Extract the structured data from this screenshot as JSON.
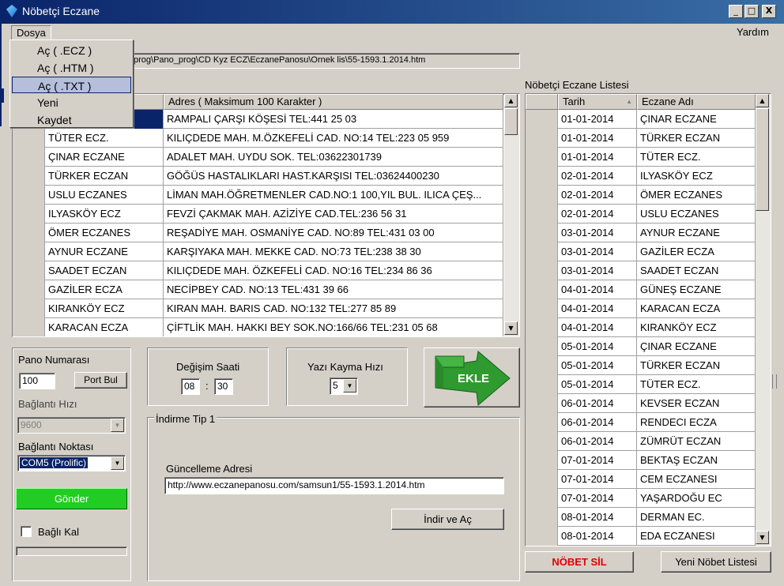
{
  "window": {
    "title": "Nöbetçi Eczane",
    "minimize": "_",
    "maximize": "□",
    "close": "X"
  },
  "menu": {
    "dosya": "Dosya",
    "yardim": "Yardım"
  },
  "dropdown": [
    "Aç ( .ECZ )",
    "Aç ( .HTM )",
    "Aç ( .TXT )",
    "Yeni",
    "Kaydet"
  ],
  "path": "prog\\Pano_prog\\CD Kyz ECZ\\EczanePanosu\\Ornek lis\\55-1593.1.2014.htm",
  "left_grid": {
    "header_addr": "Adres  ( Maksimum 100 Karakter )",
    "rows": [
      {
        "name": "",
        "addr": "RAMPALI ÇARŞI KÖŞESİ TEL:441 25 03"
      },
      {
        "name": "TÜTER ECZ.",
        "addr": "KILIÇDEDE MAH. M.ÖZKEFELİ CAD. NO:14 TEL:223 05 959"
      },
      {
        "name": "ÇINAR ECZANE",
        "addr": "ADALET MAH. UYDU SOK. TEL:03622301739"
      },
      {
        "name": "TÜRKER ECZAN",
        "addr": "GÖĞÜS HASTALIKLARI HAST.KARŞISI TEL:03624400230"
      },
      {
        "name": "USLU ECZANES",
        "addr": "LİMAN MAH.ÖĞRETMENLER CAD.NO:1 100,YIL BUL. ILICA ÇEŞ..."
      },
      {
        "name": "ILYASKÖY ECZ",
        "addr": "FEVZİ ÇAKMAK MAH. AZİZİYE CAD.TEL:236 56 31"
      },
      {
        "name": "ÖMER ECZANES",
        "addr": "REŞADİYE MAH. OSMANİYE CAD. NO:89 TEL:431 03 00"
      },
      {
        "name": "AYNUR ECZANE",
        "addr": "KARŞIYAKA MAH. MEKKE CAD. NO:73  TEL:238 38 30"
      },
      {
        "name": "SAADET ECZAN",
        "addr": "KILIÇDEDE MAH. ÖZKEFELİ CAD. NO:16 TEL:234 86 36"
      },
      {
        "name": "GAZİLER ECZA",
        "addr": "NECİPBEY CAD. NO:13 TEL:431 39 66"
      },
      {
        "name": "KIRANKÖY ECZ",
        "addr": "KIRAN MAH. BARIS CAD. NO:132 TEL:277 85 89"
      },
      {
        "name": "KARACAN ECZA",
        "addr": "ÇİFTLİK MAH. HAKKI BEY SOK.NO:166/66 TEL:231 05 68"
      }
    ]
  },
  "pano": {
    "label": "Pano Numarası",
    "value": "100",
    "port_btn": "Port Bul",
    "hiz_label": "Bağlantı Hızı",
    "hiz_value": "9600",
    "nokta_label": "Bağlantı Noktası",
    "nokta_value": "COM5 (Prolific)",
    "gonder": "Gönder",
    "bagli_kal": "Bağlı Kal"
  },
  "degisim": {
    "label": "Değişim Saati",
    "hour": "08",
    "sep": ":",
    "min": "30"
  },
  "yazi": {
    "label": "Yazı Kayma Hızı",
    "value": "5"
  },
  "ekle": {
    "label": "EKLE",
    "color": "#3aa33a"
  },
  "indirme": {
    "legend": "İndirme Tip 1",
    "addr_label": "Güncelleme Adresi",
    "addr_value": "http://www.eczanepanosu.com/samsun1/55-1593.1.2014.htm",
    "button": "İndir ve Aç"
  },
  "right_list": {
    "title": "Nöbetçi Eczane Listesi",
    "hdr_date": "Tarih",
    "hdr_name": "Eczane Adı",
    "rows": [
      {
        "date": "01-01-2014",
        "name": "ÇINAR ECZANE"
      },
      {
        "date": "01-01-2014",
        "name": "TÜRKER ECZAN"
      },
      {
        "date": "01-01-2014",
        "name": "TÜTER ECZ."
      },
      {
        "date": "02-01-2014",
        "name": "ILYASKÖY ECZ"
      },
      {
        "date": "02-01-2014",
        "name": "ÖMER ECZANES"
      },
      {
        "date": "02-01-2014",
        "name": "USLU ECZANES"
      },
      {
        "date": "03-01-2014",
        "name": "AYNUR ECZANE"
      },
      {
        "date": "03-01-2014",
        "name": "GAZİLER ECZA"
      },
      {
        "date": "03-01-2014",
        "name": "SAADET ECZAN"
      },
      {
        "date": "04-01-2014",
        "name": "GÜNEŞ ECZANE"
      },
      {
        "date": "04-01-2014",
        "name": "KARACAN ECZA"
      },
      {
        "date": "04-01-2014",
        "name": "KIRANKÖY ECZ"
      },
      {
        "date": "05-01-2014",
        "name": "ÇINAR ECZANE"
      },
      {
        "date": "05-01-2014",
        "name": "TÜRKER ECZAN"
      },
      {
        "date": "05-01-2014",
        "name": "TÜTER ECZ."
      },
      {
        "date": "06-01-2014",
        "name": "KEVSER ECZAN"
      },
      {
        "date": "06-01-2014",
        "name": "RENDECI ECZA"
      },
      {
        "date": "06-01-2014",
        "name": "ZÜMRÜT ECZAN"
      },
      {
        "date": "07-01-2014",
        "name": "BEKTAŞ ECZAN"
      },
      {
        "date": "07-01-2014",
        "name": "CEM ECZANESI"
      },
      {
        "date": "07-01-2014",
        "name": "YAŞARDOĞU EC"
      },
      {
        "date": "08-01-2014",
        "name": "DERMAN EC."
      },
      {
        "date": "08-01-2014",
        "name": "EDA ECZANESI"
      }
    ],
    "nobet_sil": "NÖBET SİL",
    "yeni": "Yeni Nöbet Listesi"
  },
  "colors": {
    "title_bar": "#0a246a",
    "selection": "#0a246a",
    "gonder_bg": "#22cc22",
    "nobet_sil_text": "#e00000"
  }
}
